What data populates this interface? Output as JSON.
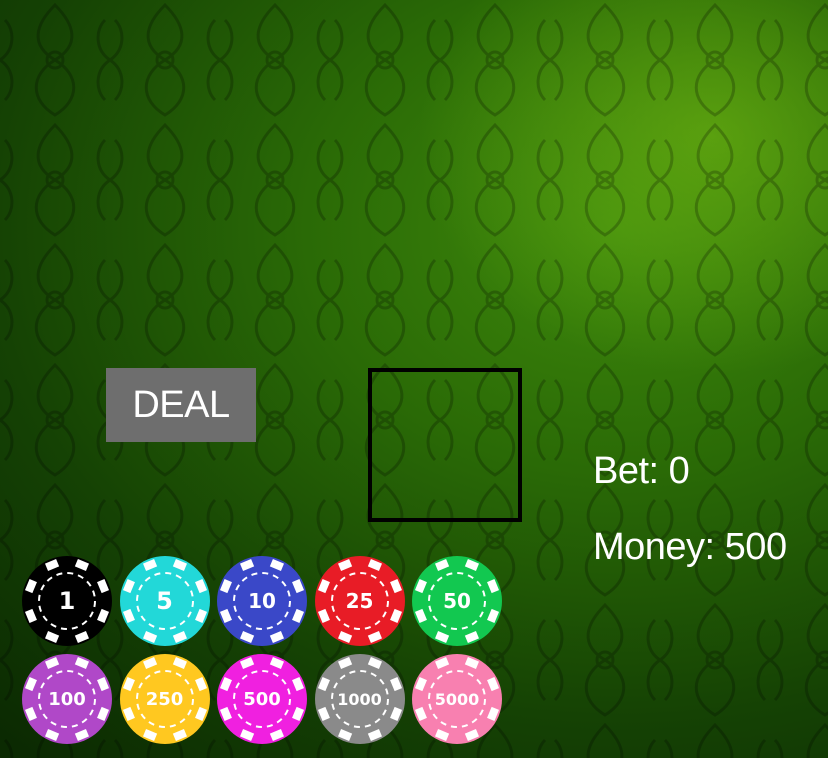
{
  "table": {
    "felt_color": "#2a6a06"
  },
  "controls": {
    "deal_label": "DEAL"
  },
  "status": {
    "bet_label": "Bet: 0",
    "money_label": "Money: 500",
    "bet": 0,
    "money": 500
  },
  "chips": [
    {
      "label": "1",
      "value": 1,
      "color": "#000000"
    },
    {
      "label": "5",
      "value": 5,
      "color": "#22d8d8"
    },
    {
      "label": "10",
      "value": 10,
      "color": "#3a48c8"
    },
    {
      "label": "25",
      "value": 25,
      "color": "#e81c26"
    },
    {
      "label": "50",
      "value": 50,
      "color": "#12c850"
    },
    {
      "label": "100",
      "value": 100,
      "color": "#b048c8"
    },
    {
      "label": "250",
      "value": 250,
      "color": "#ffc820"
    },
    {
      "label": "500",
      "value": 500,
      "color": "#f020e0"
    },
    {
      "label": "1000",
      "value": 1000,
      "color": "#8a8a8a"
    },
    {
      "label": "5000",
      "value": 5000,
      "color": "#f880b0"
    }
  ]
}
